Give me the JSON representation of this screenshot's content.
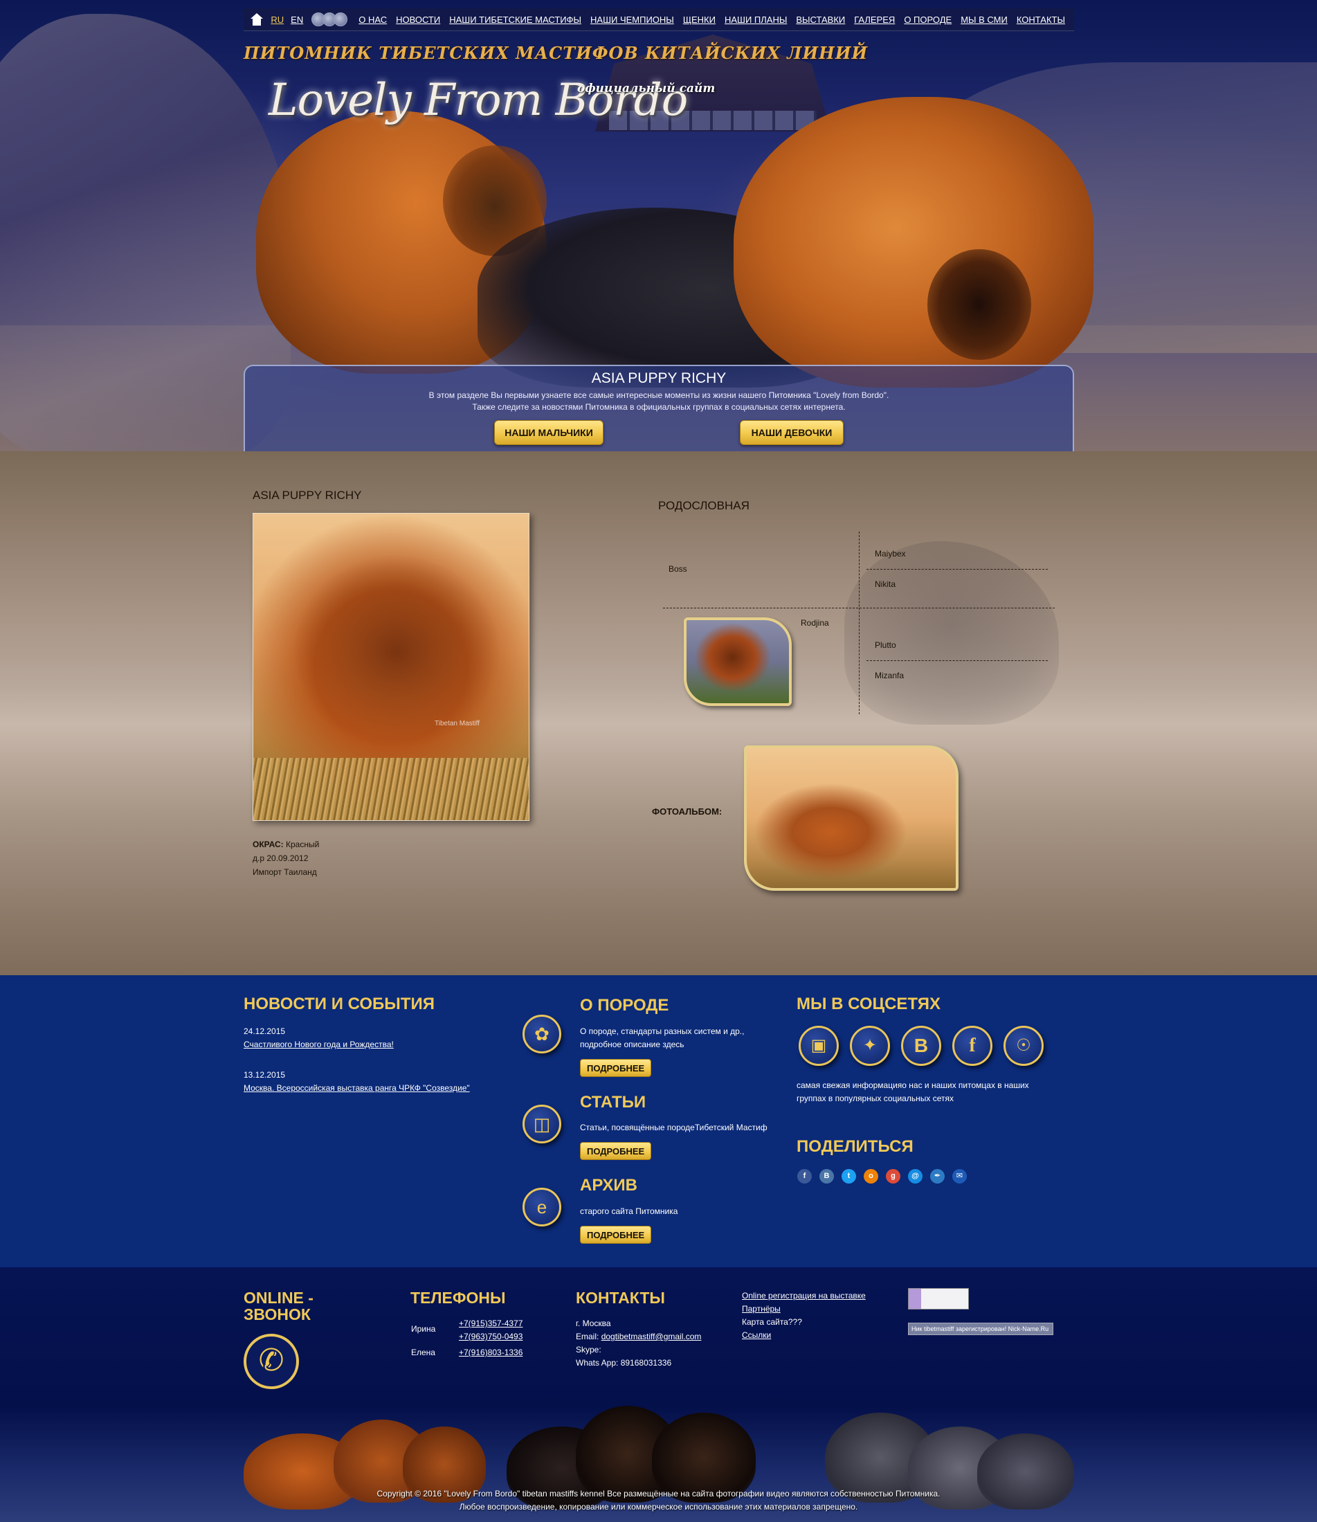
{
  "nav": {
    "lang_ru": "RU",
    "lang_en": "EN",
    "links": [
      "О НАС",
      "НОВОСТИ",
      "НАШИ ТИБЕТСКИЕ МАСТИФЫ",
      "НАШИ ЧЕМПИОНЫ",
      "ЩЕНКИ",
      "НАШИ ПЛАНЫ",
      "ВЫСТАВКИ",
      "ГАЛЕРЕЯ",
      "О ПОРОДЕ",
      "МЫ В СМИ",
      "КОНТАКТЫ"
    ]
  },
  "header": {
    "kennel_title": "ПИТОМНИК ТИБЕТСКИХ МАСТИФОВ КИТАЙСКИХ ЛИНИЙ",
    "logo": "Lovely From Bordo",
    "official": "официальный сайт"
  },
  "announce": {
    "title": "ASIA PUPPY RICHY",
    "line1": "В этом разделе Вы первыми узнаете все самые интересные моменты из жизни нашего Питомника \"Lovely from Bordo\".",
    "line2": "Также следите за новостями Питомника в официальных группах в социальных сетях интернета.",
    "btn_boys": "НАШИ МАЛЬЧИКИ",
    "btn_girls": "НАШИ ДЕВОЧКИ"
  },
  "dog": {
    "name": "ASIA PUPPY RICHY",
    "photo_watermark": "Tibetan Mastiff",
    "color_label": "ОКРАС:",
    "color_value": "Красный",
    "birth": "д.р  20.09.2012",
    "import": "Импорт Таиланд"
  },
  "pedigree": {
    "title": "РОДОСЛОВНАЯ",
    "sire": "Boss",
    "dam": "Rodjina",
    "sire_sire": "Maiybex",
    "sire_dam": "Nikita",
    "dam_sire": "Plutto",
    "dam_dam": "Mizanfa"
  },
  "album": {
    "label": "ФОТОАЛЬБОМ:"
  },
  "news": {
    "title": "НОВОСТИ И СОБЫТИЯ",
    "items": [
      {
        "date": "24.12.2015",
        "text": "Счастливого Нового года и Рождества!"
      },
      {
        "date": "13.12.2015",
        "text": "Москва. Всероссийская выставка ранга ЧРКФ \"Созвездие\""
      }
    ]
  },
  "breed": {
    "title": "О ПОРОДЕ",
    "line1": "О породе, стандарты разных систем и др.,",
    "line2": "подробное описание здесь",
    "btn": "ПОДРОБНЕЕ",
    "icon": "paw-icon"
  },
  "articles": {
    "title": "СТАТЬИ",
    "text": "Статьи, посвящённые породеТибетский Мастиф",
    "btn": "ПОДРОБНЕЕ",
    "icon": "book-icon"
  },
  "archive": {
    "title": "АРХИВ",
    "text": "старого сайта Питомника",
    "btn": "ПОДРОБНЕЕ",
    "icon": "browser-icon"
  },
  "social": {
    "title": "МЫ В СОЦСЕТЯХ",
    "line1": "самая свежая информацияо нас и наших питомцах в наших",
    "line2": "группах в популярных социальных сетях",
    "icons": [
      "instagram-icon",
      "twitter-icon",
      "vk-icon",
      "facebook-icon",
      "odnoklassniki-icon"
    ],
    "share_title": "ПОДЕЛИТЬСЯ",
    "share_icons": [
      "facebook-icon",
      "vk-icon",
      "twitter-icon",
      "odnoklassniki-icon",
      "google-plus-icon",
      "mailru-icon",
      "livejournal-icon",
      "email-icon"
    ]
  },
  "footer": {
    "callback_title_1": "ONLINE -",
    "callback_title_2": "ЗВОНОК",
    "phones_title": "ТЕЛЕФОНЫ",
    "phones": [
      {
        "name": "Ирина",
        "numbers": [
          "+7(915)357-4377",
          "+7(963)750-0493"
        ]
      },
      {
        "name": "Елена",
        "numbers": [
          "+7(916)803-1336"
        ]
      }
    ],
    "contacts_title": "КОНТАКТЫ",
    "city": "г. Москва",
    "email_label": "Email: ",
    "email": "dogtibetmastiff@gmail.com",
    "skype": "Skype:",
    "whatsapp": "Whats App: 89168031336",
    "links": [
      "Online регистрация на выставке",
      "Партнёры",
      "Карта сайта???",
      "Ссылки"
    ],
    "counter_text": "Ник tibetmastiff зарегистрирован! Nick-Name.Ru",
    "copyright_1": "Copyright © 2016 \"Lovely From Bordo\" tibetan mastiffs kennel Все размещённые на сайта фотографии видео являются собственностью Питомника.",
    "copyright_2": "Любое воспроизведение, копирование или коммерческое использование этих материалов запрещено."
  },
  "colors": {
    "gold": "#f0c958",
    "navy": "#0b2a78",
    "footer_navy": "#04104a"
  }
}
